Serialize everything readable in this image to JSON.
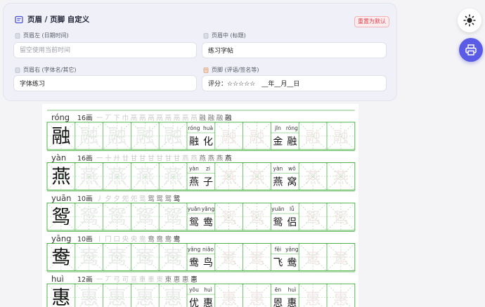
{
  "header": {
    "title": "页眉 / 页脚 自定义",
    "reset_label": "重置为默认"
  },
  "fields": {
    "left": {
      "label": "页眉左 (日期时间)",
      "value": "",
      "placeholder": "留空使用当前时间"
    },
    "center": {
      "label": "页眉中 (标题)",
      "value": "练习字帖",
      "placeholder": ""
    },
    "right": {
      "label": "页眉右 (字体名/其它)",
      "value": "字体练习",
      "placeholder": ""
    },
    "footer": {
      "label": "页脚 (评语/签名等)",
      "value": "评分：☆☆☆☆☆　__年__月__日",
      "placeholder": ""
    }
  },
  "icons": {
    "panel": "document-icon",
    "theme": "sun-icon",
    "print": "printer-icon"
  },
  "colors": {
    "accent": "#5b5ce6",
    "grid": "#4fb34a",
    "reset_text": "#d9434f"
  },
  "worksheet": {
    "entries": [
      {
        "pinyin": "róng",
        "char": "融",
        "strokes": "16画",
        "sequence": [
          "一",
          "丆",
          "下",
          "巾",
          "鬲",
          "鬲",
          "鬲",
          "鬲",
          "鬲",
          "鬲",
          "鬲",
          "鬲",
          "融",
          "融",
          "融",
          "融"
        ],
        "words": [
          {
            "pinyin": [
              "róng",
              "huà"
            ],
            "chars": [
              "融",
              "化"
            ]
          },
          {
            "pinyin": [
              "jīn",
              "róng"
            ],
            "chars": [
              "金",
              "融"
            ]
          }
        ]
      },
      {
        "pinyin": "yàn",
        "char": "燕",
        "strokes": "16画",
        "sequence": [
          "一",
          "十",
          "廾",
          "廿",
          "甘",
          "甘",
          "甘",
          "甘",
          "甘",
          "甘",
          "燕",
          "燕",
          "燕",
          "燕",
          "燕",
          "燕"
        ],
        "words": [
          {
            "pinyin": [
              "yàn",
              "zi"
            ],
            "chars": [
              "燕",
              "子"
            ]
          },
          {
            "pinyin": [
              "yàn",
              "wō"
            ],
            "chars": [
              "燕",
              "窝"
            ]
          }
        ]
      },
      {
        "pinyin": "yuān",
        "char": "鸳",
        "strokes": "10画",
        "sequence": [
          "丿",
          "夕",
          "夕",
          "夗",
          "夗",
          "鸳",
          "鸳",
          "鸳",
          "鸳",
          "鸳"
        ],
        "words": [
          {
            "pinyin": [
              "yuān",
              "yāng"
            ],
            "chars": [
              "鸳",
              "鸯"
            ]
          },
          {
            "pinyin": [
              "yuān",
              "lǚ"
            ],
            "chars": [
              "鸳",
              "侣"
            ]
          }
        ]
      },
      {
        "pinyin": "yāng",
        "char": "鸯",
        "strokes": "10画",
        "sequence": [
          "丨",
          "冂",
          "口",
          "央",
          "央",
          "鸯",
          "鸯",
          "鸯",
          "鸯",
          "鸯"
        ],
        "words": [
          {
            "pinyin": [
              "yāng",
              "niǎo"
            ],
            "chars": [
              "鸯",
              "鸟"
            ]
          },
          {
            "pinyin": [
              "fēi",
              "yāng"
            ],
            "chars": [
              "飞",
              "鸯"
            ]
          }
        ]
      },
      {
        "pinyin": "huì",
        "char": "惠",
        "strokes": "12画",
        "sequence": [
          "一",
          "丆",
          "弓",
          "可",
          "亘",
          "車",
          "車",
          "東",
          "東",
          "惠",
          "惠",
          "惠"
        ],
        "words": [
          {
            "pinyin": [
              "yōu",
              "huì"
            ],
            "chars": [
              "优",
              "惠"
            ]
          },
          {
            "pinyin": [
              "ēn",
              "huì"
            ],
            "chars": [
              "恩",
              "惠"
            ]
          }
        ]
      }
    ]
  }
}
